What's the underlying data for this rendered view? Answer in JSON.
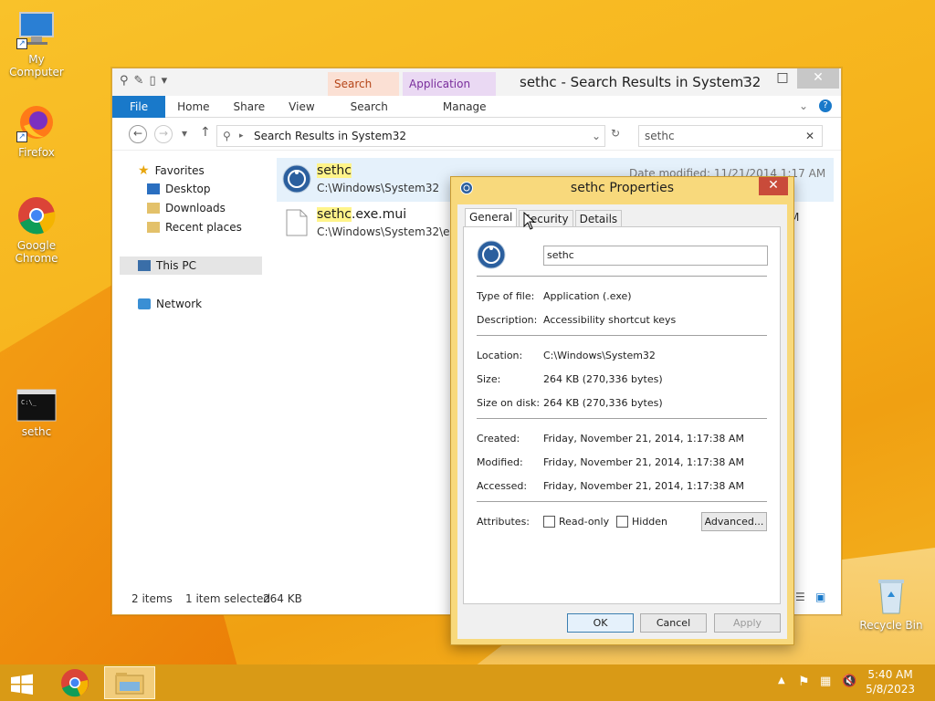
{
  "desktop": {
    "icons": [
      {
        "label": "My Computer"
      },
      {
        "label": "Firefox"
      },
      {
        "label": "Google Chrome"
      },
      {
        "label": "sethc"
      },
      {
        "label": "Recycle Bin"
      }
    ]
  },
  "explorer": {
    "title": "sethc - Search Results in System32",
    "context_tabs": {
      "search_tools": "Search Tools",
      "application_tools": "Application Tools"
    },
    "ribbon_tabs": [
      "File",
      "Home",
      "Share",
      "View",
      "Search",
      "Manage"
    ],
    "address": "Search Results in System32",
    "search_value": "sethc",
    "nav": {
      "favorites": "Favorites",
      "desktop": "Desktop",
      "downloads": "Downloads",
      "recent": "Recent places",
      "this_pc": "This PC",
      "network": "Network"
    },
    "files": [
      {
        "name_hl": "sethc",
        "name_rest": "",
        "path": "C:\\Windows\\System32",
        "meta": "Date modified: 11/21/2014 1:17 AM"
      },
      {
        "name_hl": "sethc",
        "name_rest": ".exe.mui",
        "path": "C:\\Windows\\System32\\en-U",
        "meta": "M"
      }
    ],
    "status": {
      "count": "2 items",
      "selected": "1 item selected",
      "size": "264 KB"
    }
  },
  "dialog": {
    "title": "sethc Properties",
    "tabs": [
      "General",
      "Security",
      "Details"
    ],
    "name_value": "sethc",
    "rows": {
      "type_label": "Type of file:",
      "type_value": "Application (.exe)",
      "desc_label": "Description:",
      "desc_value": "Accessibility shortcut keys",
      "loc_label": "Location:",
      "loc_value": "C:\\Windows\\System32",
      "size_label": "Size:",
      "size_value": "264 KB (270,336 bytes)",
      "disk_label": "Size on disk:",
      "disk_value": "264 KB (270,336 bytes)",
      "created_label": "Created:",
      "created_value": "Friday, November 21, 2014, 1:17:38 AM",
      "modified_label": "Modified:",
      "modified_value": "Friday, November 21, 2014, 1:17:38 AM",
      "accessed_label": "Accessed:",
      "accessed_value": "Friday, November 21, 2014, 1:17:38 AM",
      "attr_label": "Attributes:"
    },
    "readonly_label": "Read-only",
    "hidden_label": "Hidden",
    "advanced_label": "Advanced...",
    "ok_label": "OK",
    "cancel_label": "Cancel",
    "apply_label": "Apply"
  },
  "taskbar": {
    "time": "5:40 AM",
    "date": "5/8/2023"
  },
  "colors": {
    "accent": "#1979ca",
    "taskbar": "#d99a16"
  }
}
